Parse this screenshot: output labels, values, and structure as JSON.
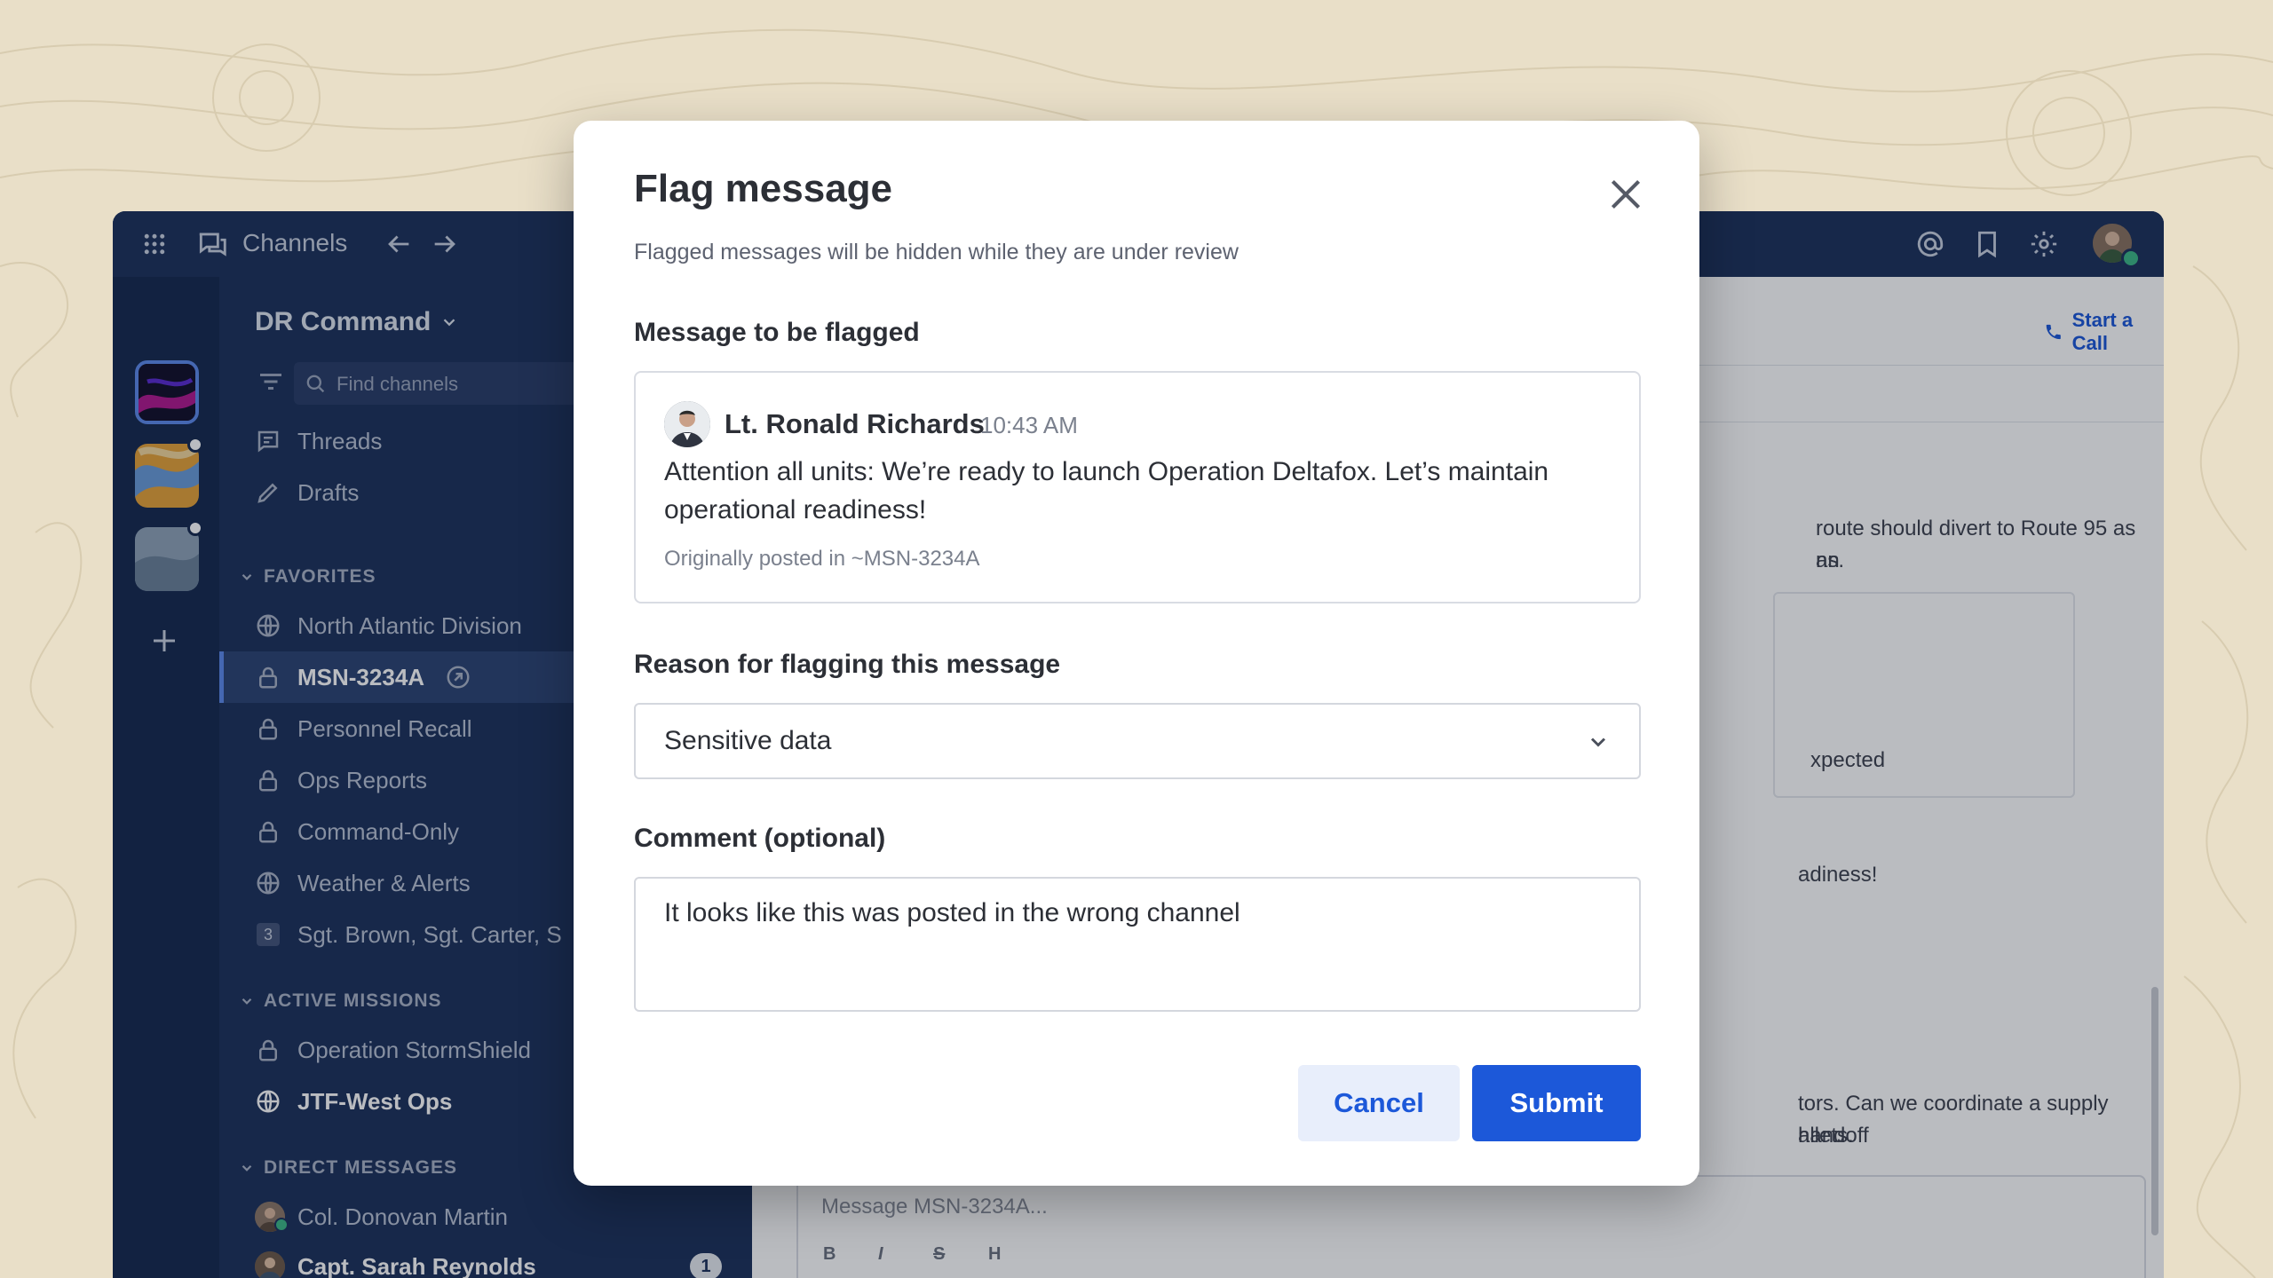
{
  "app": {
    "name": "Channels",
    "team_name": "DR Command",
    "find_placeholder": "Find channels"
  },
  "sidebar": {
    "nav": [
      {
        "label": "Threads",
        "icon": "threads-icon"
      },
      {
        "label": "Drafts",
        "icon": "pencil-icon"
      }
    ],
    "favorites_header": "FAVORITES",
    "favorites": [
      {
        "label": "North Atlantic Division",
        "icon": "globe-icon"
      },
      {
        "label": "MSN-3234A",
        "icon": "lock-icon",
        "active": true
      },
      {
        "label": "Personnel Recall",
        "icon": "lock-icon"
      },
      {
        "label": "Ops Reports",
        "icon": "lock-icon"
      },
      {
        "label": "Command-Only",
        "icon": "lock-icon"
      },
      {
        "label": "Weather & Alerts",
        "icon": "globe-icon"
      },
      {
        "label": "Sgt. Brown, Sgt. Carter, S",
        "icon": "group-dm-icon",
        "count": "3"
      }
    ],
    "active_header": "ACTIVE MISSIONS",
    "active": [
      {
        "label": "Operation StormShield",
        "icon": "lock-icon"
      },
      {
        "label": "JTF-West Ops",
        "icon": "globe-icon",
        "bold": true
      }
    ],
    "dm_header": "DIRECT MESSAGES",
    "dms": [
      {
        "label": "Col. Donovan Martin"
      },
      {
        "label": "Capt. Sarah Reynolds",
        "badge": "1"
      }
    ]
  },
  "main": {
    "start_call": "Start a Call",
    "msg_line1": "route should divert to Route 95 as an",
    "msg_line2": "ns.",
    "card_text": "xpected",
    "msg_readiness": "adiness!",
    "msg_line3": "tors. Can we coordinate a supply handoff",
    "msg_line4": "allets.",
    "composer_placeholder": "Message MSN-3234A..."
  },
  "modal": {
    "title": "Flag message",
    "subtitle": "Flagged messages will be hidden while they are under review",
    "message_label": "Message to be flagged",
    "author": "Lt. Ronald Richards",
    "time": "10:43 AM",
    "body": "Attention all units: We’re ready to launch Operation Deltafox. Let’s maintain operational readiness!",
    "origin": "Originally posted in ~MSN-3234A",
    "reason_label": "Reason for flagging this message",
    "reason_value": "Sensitive data",
    "comment_label": "Comment (optional)",
    "comment_value": "It looks like this was posted in the wrong channel",
    "cancel": "Cancel",
    "submit": "Submit"
  },
  "colors": {
    "sidebar": "#1e325c",
    "accent": "#1c58d9",
    "background": "#e9dfc8",
    "online": "#3db887"
  }
}
